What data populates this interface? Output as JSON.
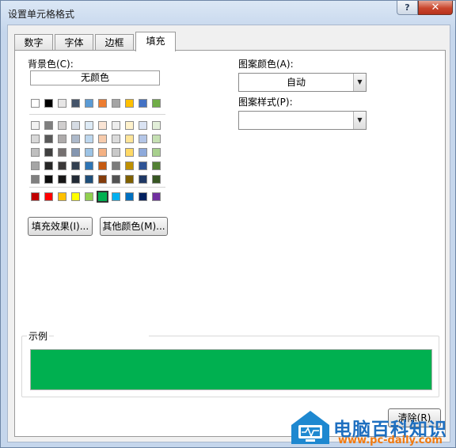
{
  "window": {
    "title": "设置单元格格式",
    "help_label": "?",
    "close_label": "✕"
  },
  "tabs": [
    {
      "label": "数字",
      "active": false
    },
    {
      "label": "字体",
      "active": false
    },
    {
      "label": "边框",
      "active": false
    },
    {
      "label": "填充",
      "active": true
    }
  ],
  "fill": {
    "background_label": "背景色(C):",
    "no_color_label": "无颜色",
    "selected_color": "#00b050",
    "theme_row": [
      "#ffffff",
      "#000000",
      "#eeece1",
      "#1f497d",
      "#4f81bd",
      "#c0504d",
      "#9bbb59",
      "#8064a2",
      "#4bacc6",
      "#f79646"
    ],
    "display_theme_row": [
      "#ffffff",
      "#000000",
      "#e7e6e6",
      "#44546a",
      "#5b9bd5",
      "#ed7d31",
      "#a5a5a5",
      "#ffc000",
      "#4472c4",
      "#70ad47"
    ],
    "shade_rows": [
      [
        "#f2f2f2",
        "#7f7f7f",
        "#d0cece",
        "#d6dce4",
        "#deebf6",
        "#fbe5d5",
        "#ededed",
        "#fff2cc",
        "#dae3f3",
        "#e2efd9"
      ],
      [
        "#d8d8d8",
        "#595959",
        "#aeabab",
        "#adb9ca",
        "#bdd7ee",
        "#f7cbac",
        "#dbdbdb",
        "#fee599",
        "#b4c6e7",
        "#c5e0b3"
      ],
      [
        "#bfbfbf",
        "#3f3f3f",
        "#757070",
        "#8496b0",
        "#9cc3e5",
        "#f4b183",
        "#c9c9c9",
        "#ffd965",
        "#8eaadb",
        "#a8d08d"
      ],
      [
        "#a5a5a5",
        "#262626",
        "#3a3838",
        "#323f4f",
        "#2e75b5",
        "#c55a11",
        "#7b7b7b",
        "#bf9000",
        "#2f5496",
        "#538135"
      ],
      [
        "#7f7f7f",
        "#0c0c0c",
        "#171616",
        "#222a35",
        "#1e4e79",
        "#833c0b",
        "#525252",
        "#7f6000",
        "#1f3864",
        "#375623"
      ]
    ],
    "standard_row": [
      "#c00000",
      "#ff0000",
      "#ffc000",
      "#ffff00",
      "#92d050",
      "#00b050",
      "#00b0f0",
      "#0070c0",
      "#002060",
      "#7030a0"
    ],
    "fill_effects_label": "填充效果(I)...",
    "more_colors_label": "其他颜色(M)..."
  },
  "pattern": {
    "color_label": "图案颜色(A):",
    "color_value": "自动",
    "style_label": "图案样式(P):",
    "style_value": ""
  },
  "sample": {
    "label": "示例"
  },
  "clear_label": "清除(R)",
  "watermark": {
    "cn": "电脑百科知识",
    "url": "www.pc-daily.com"
  }
}
